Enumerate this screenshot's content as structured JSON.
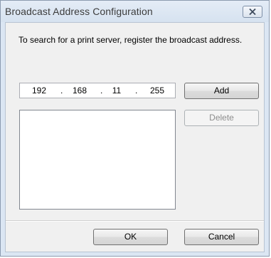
{
  "window": {
    "title": "Broadcast Address Configuration"
  },
  "instruction": "To search for a print server, register the broadcast address.",
  "ip_address": {
    "octets": [
      "192",
      "168",
      "11",
      "255"
    ],
    "separator": "."
  },
  "buttons": {
    "add": "Add",
    "delete": "Delete",
    "ok": "OK",
    "cancel": "Cancel"
  },
  "address_list": [],
  "colors": {
    "frame": "#dbe6f3",
    "client": "#f0f0f0",
    "disabled_text": "#8d8d8d"
  }
}
